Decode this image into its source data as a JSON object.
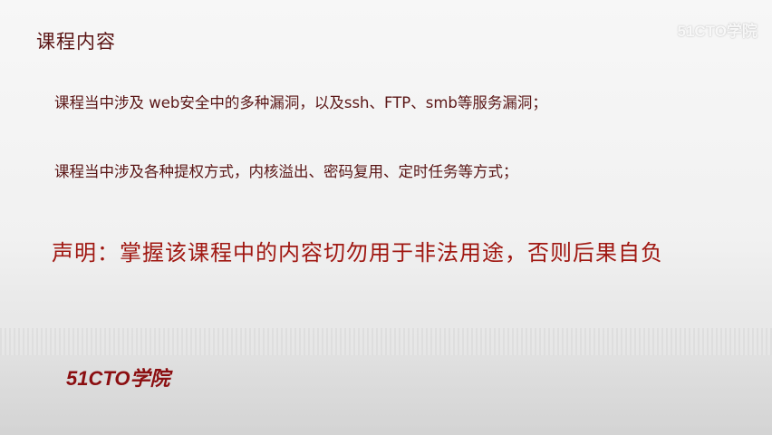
{
  "slide": {
    "title": "课程内容",
    "bullets": [
      "课程当中涉及 web安全中的多种漏洞，以及ssh、FTP、smb等服务漏洞；",
      "课程当中涉及各种提权方式，内核溢出、密码复用、定时任务等方式；"
    ],
    "disclaimer": "声明：掌握该课程中的内容切勿用于非法用途，否则后果自负"
  },
  "footer": {
    "logo_text": "51CTO学院"
  },
  "watermark": {
    "text": "51CTO学院"
  },
  "colors": {
    "title": "#5a1414",
    "body": "#5a1616",
    "disclaimer": "#a01812",
    "logo": "#8b0e10"
  }
}
